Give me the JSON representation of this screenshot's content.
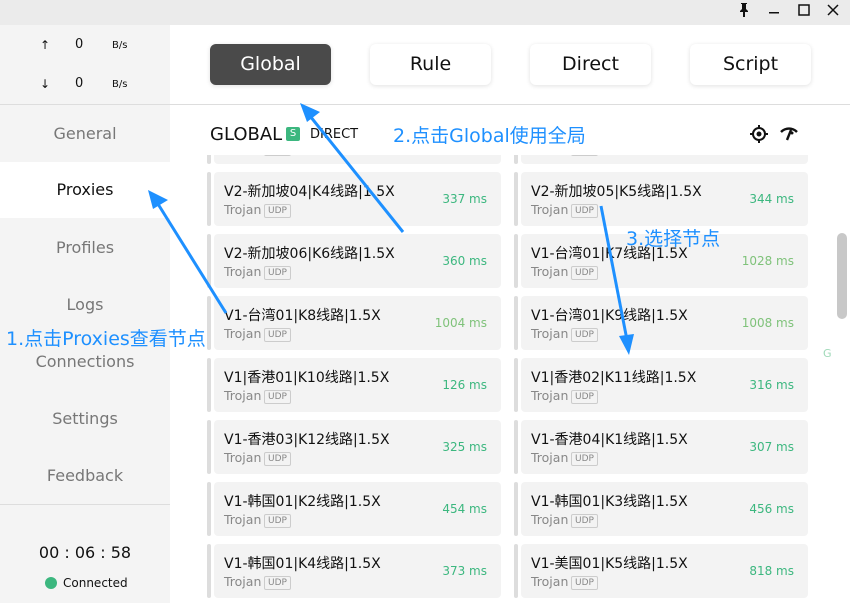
{
  "window": {
    "controls": [
      {
        "name": "pin-icon",
        "glyph": "📌"
      },
      {
        "name": "minimize-icon",
        "glyph": "—"
      },
      {
        "name": "maximize-icon",
        "glyph": "☐"
      },
      {
        "name": "close-icon",
        "glyph": "✕"
      }
    ]
  },
  "sidebar": {
    "upload": {
      "arrow": "↑",
      "value": "0",
      "unit": "B/s"
    },
    "download": {
      "arrow": "↓",
      "value": "0",
      "unit": "B/s"
    },
    "items": [
      {
        "label": "General"
      },
      {
        "label": "Proxies"
      },
      {
        "label": "Profiles"
      },
      {
        "label": "Logs"
      },
      {
        "label": "Connections"
      },
      {
        "label": "Settings"
      },
      {
        "label": "Feedback"
      }
    ],
    "active": "Proxies",
    "timer": "00 : 06 : 58",
    "status": "Connected",
    "status_color": "#3cb77f"
  },
  "modes": [
    {
      "label": "Global"
    },
    {
      "label": "Rule"
    },
    {
      "label": "Direct"
    },
    {
      "label": "Script"
    }
  ],
  "active_mode": "Global",
  "group": {
    "title": "GLOBAL",
    "badge": "S",
    "selected": "DIRECT",
    "icons": [
      "locate-icon",
      "speed-test-icon"
    ]
  },
  "proxies": [
    {
      "name": "",
      "type": "Trojan",
      "udp": "UDP",
      "latency": ""
    },
    {
      "name": "",
      "type": "Trojan",
      "udp": "UDP",
      "latency": ""
    },
    {
      "name": "V2-新加坡04|K4线路|1.5X",
      "type": "Trojan",
      "udp": "UDP",
      "latency": "337 ms"
    },
    {
      "name": "V2-新加坡05|K5线路|1.5X",
      "type": "Trojan",
      "udp": "UDP",
      "latency": "344 ms"
    },
    {
      "name": "V2-新加坡06|K6线路|1.5X",
      "type": "Trojan",
      "udp": "UDP",
      "latency": "360 ms"
    },
    {
      "name": "V1-台湾01|K7线路|1.5X",
      "type": "Trojan",
      "udp": "UDP",
      "latency": "1028 ms"
    },
    {
      "name": "V1-台湾01|K8线路|1.5X",
      "type": "Trojan",
      "udp": "UDP",
      "latency": "1004 ms"
    },
    {
      "name": "V1-台湾01|K9线路|1.5X",
      "type": "Trojan",
      "udp": "UDP",
      "latency": "1008 ms"
    },
    {
      "name": "V1|香港01|K10线路|1.5X",
      "type": "Trojan",
      "udp": "UDP",
      "latency": "126 ms"
    },
    {
      "name": "V1|香港02|K11线路|1.5X",
      "type": "Trojan",
      "udp": "UDP",
      "latency": "316 ms"
    },
    {
      "name": "V1-香港03|K12线路|1.5X",
      "type": "Trojan",
      "udp": "UDP",
      "latency": "325 ms"
    },
    {
      "name": "V1-香港04|K1线路|1.5X",
      "type": "Trojan",
      "udp": "UDP",
      "latency": "307 ms"
    },
    {
      "name": "V1-韩国01|K2线路|1.5X",
      "type": "Trojan",
      "udp": "UDP",
      "latency": "454 ms"
    },
    {
      "name": "V1-韩国01|K3线路|1.5X",
      "type": "Trojan",
      "udp": "UDP",
      "latency": "456 ms"
    },
    {
      "name": "V1-韩国01|K4线路|1.5X",
      "type": "Trojan",
      "udp": "UDP",
      "latency": "373 ms"
    },
    {
      "name": "V1-美国01|K5线路|1.5X",
      "type": "Trojan",
      "udp": "UDP",
      "latency": "818 ms"
    }
  ],
  "side_letter": "G",
  "annotations": {
    "step1": "1.点击Proxies查看节点",
    "step2": "2.点击Global使用全局",
    "step3": "3.选择节点",
    "color": "#1e90ff"
  }
}
